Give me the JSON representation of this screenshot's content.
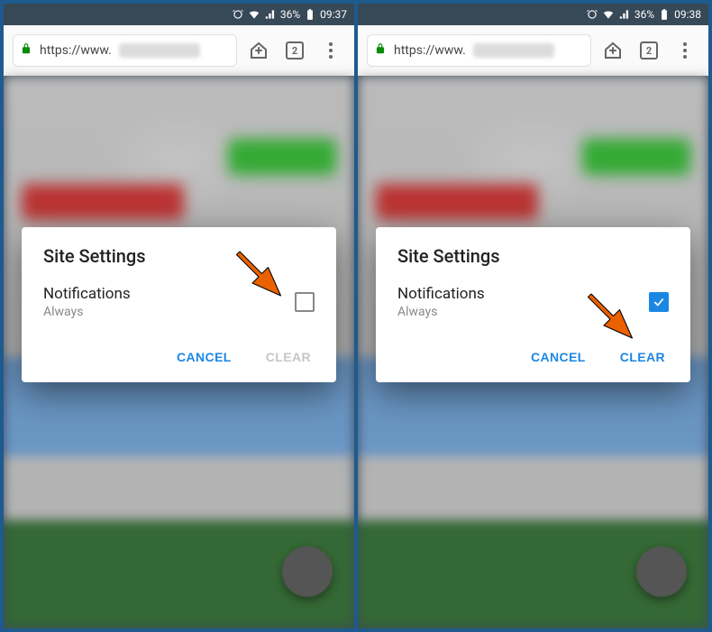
{
  "panels": [
    {
      "status": {
        "battery_pct": "36%",
        "time": "09:37"
      },
      "browser": {
        "url_scheme": "https://www.",
        "tab_count": "2"
      },
      "dialog": {
        "title": "Site Settings",
        "item_label": "Notifications",
        "item_sub": "Always",
        "checked": false,
        "cancel_label": "CANCEL",
        "clear_label": "CLEAR",
        "clear_enabled": false
      },
      "arrow_target": "checkbox"
    },
    {
      "status": {
        "battery_pct": "36%",
        "time": "09:38"
      },
      "browser": {
        "url_scheme": "https://www.",
        "tab_count": "2"
      },
      "dialog": {
        "title": "Site Settings",
        "item_label": "Notifications",
        "item_sub": "Always",
        "checked": true,
        "cancel_label": "CANCEL",
        "clear_label": "CLEAR",
        "clear_enabled": true
      },
      "arrow_target": "clear"
    }
  ]
}
